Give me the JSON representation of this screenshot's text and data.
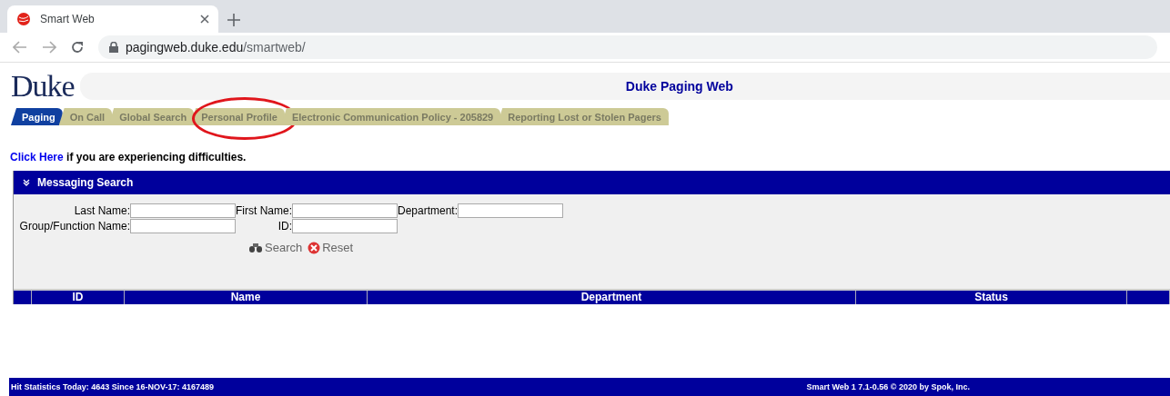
{
  "browser": {
    "tab_title": "Smart Web",
    "url_host": "pagingweb.duke.edu",
    "url_path": "/smartweb/"
  },
  "header": {
    "logo": "Duke",
    "title": "Duke Paging Web"
  },
  "tabs": [
    {
      "label": "Paging",
      "selected": true,
      "circled": false
    },
    {
      "label": "On Call",
      "selected": false,
      "circled": false
    },
    {
      "label": "Global Search",
      "selected": false,
      "circled": false
    },
    {
      "label": "Personal Profile",
      "selected": false,
      "circled": true
    },
    {
      "label": "Electronic Communication Policy - 205829",
      "selected": false,
      "circled": false
    },
    {
      "label": "Reporting Lost or Stolen Pagers",
      "selected": false,
      "circled": false
    }
  ],
  "notice": {
    "link": "Click Here",
    "text": "if you are experiencing difficulties."
  },
  "panel": {
    "title": "Messaging Search",
    "fields": [
      {
        "label": "Last Name:"
      },
      {
        "label": "First Name:"
      },
      {
        "label": "Department:"
      },
      {
        "label": "Group/Function Name:"
      },
      {
        "label": "ID:"
      }
    ],
    "buttons": [
      {
        "label": "Search",
        "kind": "search"
      },
      {
        "label": "Reset",
        "kind": "reset"
      }
    ]
  },
  "table": {
    "columns": [
      "ID",
      "Name",
      "Department",
      "Status"
    ]
  },
  "status_bar": {
    "left": "Hit Statistics Today: 4643 Since 16-NOV-17: 4167489",
    "right": "Smart Web 1 7.1-0.56 © 2020 by Spok, Inc."
  }
}
